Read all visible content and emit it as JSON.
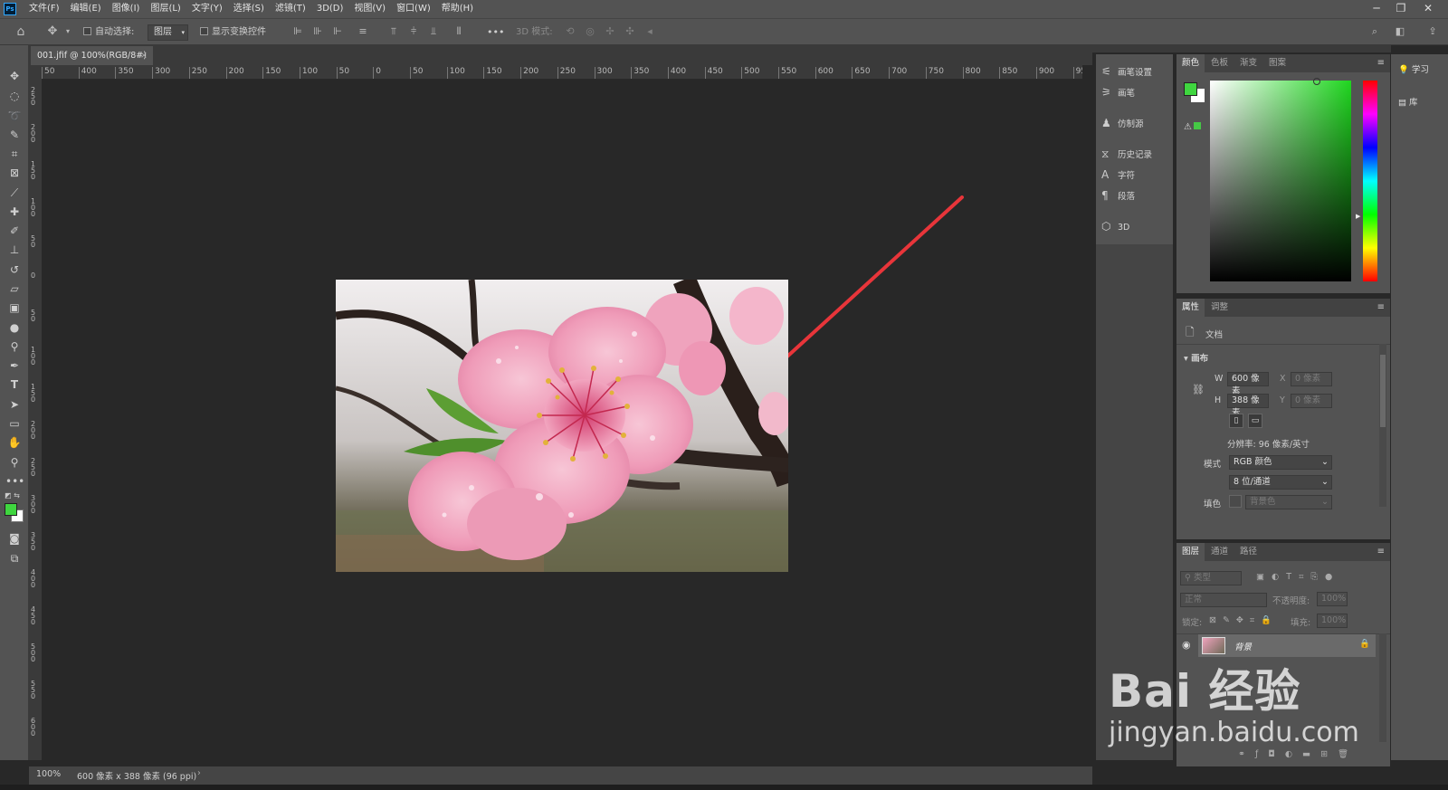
{
  "app": {
    "name": "Adobe Photoshop",
    "logo_text": "Ps"
  },
  "menubar": {
    "items": [
      "文件(F)",
      "编辑(E)",
      "图像(I)",
      "图层(L)",
      "文字(Y)",
      "选择(S)",
      "滤镜(T)",
      "3D(D)",
      "视图(V)",
      "窗口(W)",
      "帮助(H)"
    ],
    "window_controls": [
      "minimize",
      "restore",
      "close"
    ]
  },
  "options_bar": {
    "auto_select_label": "自动选择:",
    "auto_select_target": "图层",
    "show_transform_label": "显示变换控件",
    "more": "•••",
    "mode_3d_label": "3D 模式:"
  },
  "document": {
    "tab_title": "001.jfif @ 100%(RGB/8#)",
    "zoom": "100%",
    "dimensions_status": "600 像素 x 388 像素 (96 ppi)"
  },
  "rulers": {
    "horizontal": [
      "50",
      "400",
      "350",
      "300",
      "250",
      "200",
      "150",
      "100",
      "50",
      "0",
      "50",
      "100",
      "150",
      "200",
      "250",
      "300",
      "350",
      "400",
      "450",
      "500",
      "550",
      "600",
      "650",
      "700",
      "750",
      "800",
      "850",
      "900",
      "950"
    ],
    "vertical": [
      "2 5 0",
      "2 0 0",
      "1 5 0",
      "1 0 0",
      "5 0",
      "0",
      "5 0",
      "1 0 0",
      "1 5 0",
      "2 0 0",
      "2 5 0",
      "3 0 0",
      "3 5 0",
      "4 0 0",
      "4 5 0",
      "5 0 0",
      "5 5 0",
      "6 0 0"
    ]
  },
  "dock_panels": [
    {
      "icon": "brush-settings-icon",
      "label": "画笔设置"
    },
    {
      "icon": "brush-icon",
      "label": "画笔"
    },
    {
      "icon": "clone-source-icon",
      "label": "仿制源"
    },
    {
      "icon": "history-icon",
      "label": "历史记录"
    },
    {
      "icon": "character-icon",
      "label": "字符"
    },
    {
      "icon": "paragraph-icon",
      "label": "段落"
    },
    {
      "icon": "cube-3d-icon",
      "label": "3D"
    }
  ],
  "color_panel": {
    "tabs": [
      "颜色",
      "色板",
      "渐变",
      "图案"
    ],
    "foreground": "#3fd63f",
    "background": "#ffffff",
    "hue_color": "#1fd61f"
  },
  "properties_panel": {
    "tabs": [
      "属性",
      "调整"
    ],
    "doc_label": "文档",
    "section": "画布",
    "w_label": "W",
    "w_value": "600 像素",
    "h_label": "H",
    "h_value": "388 像素",
    "x_label": "X",
    "x_value": "0 像素",
    "y_label": "Y",
    "y_value": "0 像素",
    "resolution": "分辨率: 96 像素/英寸",
    "mode_label": "模式",
    "mode_value": "RGB 颜色",
    "depth_value": "8 位/通道",
    "fill_label": "填色",
    "fill_value": "背景色"
  },
  "layers_panel": {
    "tabs": [
      "图层",
      "通道",
      "路径"
    ],
    "filter_placeholder": "类型",
    "blend_mode": "正常",
    "opacity_label": "不透明度:",
    "opacity_value": "100%",
    "lock_label": "锁定:",
    "fill_label": "填充:",
    "fill_value": "100%",
    "layers": [
      {
        "name": "背景",
        "visible": true,
        "locked": true
      }
    ]
  },
  "learn_panel": {
    "items": [
      "学习",
      "库"
    ]
  },
  "watermark": {
    "brand": "Bai 经验",
    "url": "jingyan.baidu.com"
  },
  "colors": {
    "ui_bg": "#535353",
    "canvas_bg": "#282828",
    "arrow": "#e8353a"
  }
}
